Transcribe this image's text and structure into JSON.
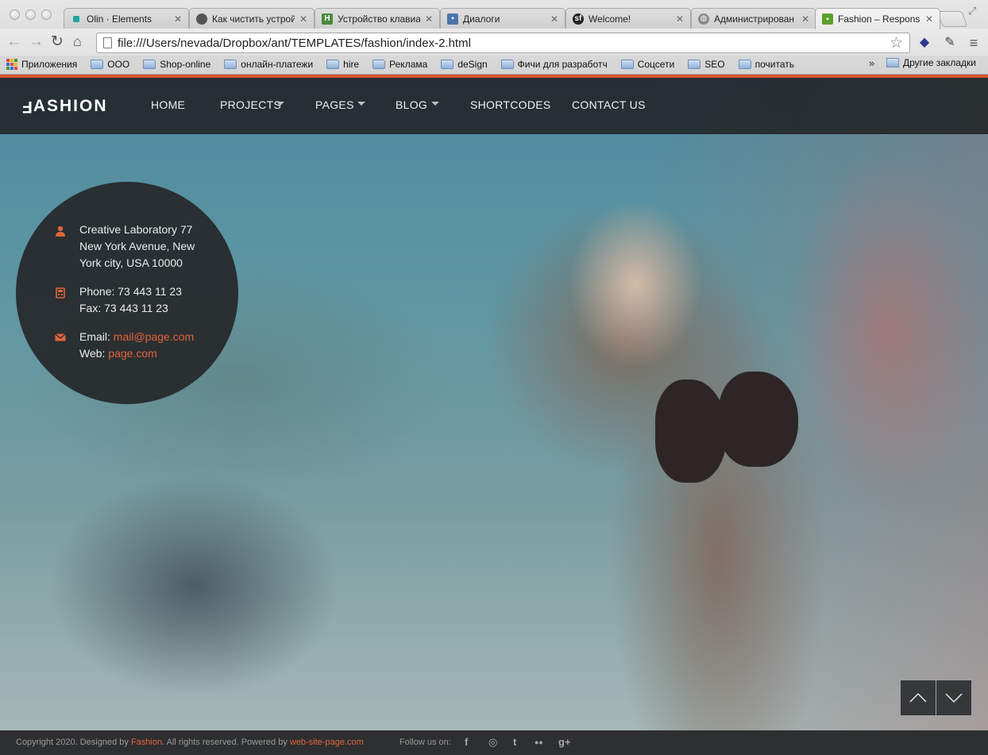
{
  "browser": {
    "tabs": [
      {
        "label": "Olin · Elements",
        "icon": "square-favicon-icon"
      },
      {
        "label": "Как чистить устрой",
        "icon": "apple-favicon-icon"
      },
      {
        "label": "Устройство клавиа",
        "icon": "h-favicon-icon"
      },
      {
        "label": "Диалоги",
        "icon": "chat-favicon-icon"
      },
      {
        "label": "Welcome!",
        "icon": "symfony-favicon-icon"
      },
      {
        "label": "Администрирован",
        "icon": "globe-favicon-icon"
      },
      {
        "label": "Fashion – Responsi",
        "icon": "speech-favicon-icon"
      }
    ],
    "url": "file:///Users/nevada/Dropbox/ant/TEMPLATES/fashion/index-2.html",
    "bookmarks": [
      {
        "label": "Приложения",
        "icon": "apps-grid-icon"
      },
      {
        "label": "OOO",
        "icon": "folder-icon"
      },
      {
        "label": "Shop-online",
        "icon": "folder-icon"
      },
      {
        "label": "онлайн-платежи",
        "icon": "folder-icon"
      },
      {
        "label": "hire",
        "icon": "folder-icon"
      },
      {
        "label": "Реклама",
        "icon": "folder-icon"
      },
      {
        "label": "deSign",
        "icon": "folder-icon"
      },
      {
        "label": "Фичи для разработч",
        "icon": "folder-icon"
      },
      {
        "label": "Соцсети",
        "icon": "folder-icon"
      },
      {
        "label": "SEO",
        "icon": "folder-icon"
      },
      {
        "label": "почитать",
        "icon": "folder-icon"
      }
    ],
    "more_bookmarks": "»",
    "other_bookmarks": "Другие закладки"
  },
  "site": {
    "logo": {
      "flipped_letter": "F",
      "rest": "ASHION"
    },
    "nav": {
      "home": "HOME",
      "projects": "PROJECTS",
      "pages": "PAGES",
      "blog": "BLOG",
      "shortcodes": "SHORTCODES",
      "contact": "CONTACT US"
    },
    "contact": {
      "address_line1": "Creative Laboratory 77",
      "address_line2": "New York Avenue, New",
      "address_line3": "York city, USA 10000",
      "phone": "Phone: 73 443 11 23",
      "fax": "Fax: 73 443 11 23",
      "email_label": "Email: ",
      "email": "mail@page.com",
      "web_label": "Web: ",
      "web": "page.com"
    },
    "footer": {
      "copy_prefix": "Copyright 2020. Designed by ",
      "designer": "Fashion",
      "copy_middle": ". All rights reserved. Powered by ",
      "powered": "web-site-page.com",
      "follow": "Follow us on:",
      "social": [
        {
          "glyph": "f",
          "icon": "facebook-icon"
        },
        {
          "glyph": "◎",
          "icon": "dribbble-icon"
        },
        {
          "glyph": "t",
          "icon": "twitter-icon"
        },
        {
          "glyph": "●●",
          "icon": "flickr-icon"
        },
        {
          "glyph": "g+",
          "icon": "google-plus-icon"
        }
      ]
    },
    "colors": {
      "accent": "#e0643c",
      "header_bg": "#202224",
      "footer_bg": "#2e2f30"
    }
  }
}
